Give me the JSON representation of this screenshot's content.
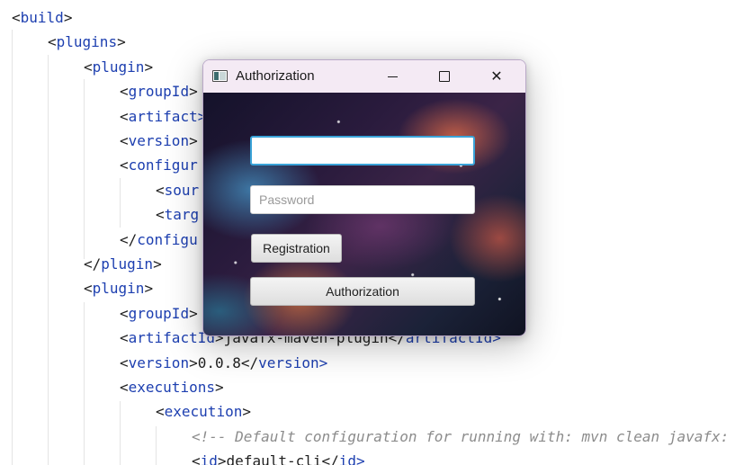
{
  "editor": {
    "lines": [
      {
        "indent": 0,
        "open": "<",
        "tag": "build",
        "close": ">",
        "text": "",
        "end": ""
      },
      {
        "indent": 1,
        "open": "<",
        "tag": "plugins",
        "close": ">",
        "text": "",
        "end": ""
      },
      {
        "indent": 2,
        "open": "<",
        "tag": "plugin",
        "close": ">",
        "text": "",
        "end": ""
      },
      {
        "indent": 3,
        "open": "<",
        "tag": "groupId",
        "close": ">",
        "text": "",
        "end": ""
      },
      {
        "indent": 3,
        "open": "<",
        "tag": "artifact",
        "close": "",
        "text": "",
        "end": ">"
      },
      {
        "indent": 3,
        "open": "<",
        "tag": "version",
        "close": ">",
        "text": "",
        "end": ""
      },
      {
        "indent": 3,
        "open": "<",
        "tag": "configur",
        "close": "",
        "text": "",
        "end": ""
      },
      {
        "indent": 4,
        "open": "<",
        "tag": "sour",
        "close": "",
        "text": "",
        "end": ""
      },
      {
        "indent": 4,
        "open": "<",
        "tag": "targ",
        "close": "",
        "text": "",
        "end": ""
      },
      {
        "indent": 3,
        "open": "</",
        "tag": "configu",
        "close": "",
        "text": "",
        "end": ""
      },
      {
        "indent": 2,
        "open": "</",
        "tag": "plugin",
        "close": ">",
        "text": "",
        "end": ""
      },
      {
        "indent": 2,
        "open": "<",
        "tag": "plugin",
        "close": ">",
        "text": "",
        "end": ""
      },
      {
        "indent": 3,
        "open": "<",
        "tag": "groupId",
        "close": ">",
        "text": "",
        "end": ""
      },
      {
        "indent": 3,
        "open": "<",
        "tag": "artifactId",
        "close": ">",
        "text": "javafx-maven-plugin</",
        "end": "artifactId>"
      },
      {
        "indent": 3,
        "open": "<",
        "tag": "version",
        "close": ">",
        "text": "0.0.8</",
        "end": "version>"
      },
      {
        "indent": 3,
        "open": "<",
        "tag": "executions",
        "close": ">",
        "text": "",
        "end": ""
      },
      {
        "indent": 4,
        "open": "<",
        "tag": "execution",
        "close": ">",
        "text": "",
        "end": ""
      },
      {
        "indent": 5,
        "comment": "<!-- Default configuration for running with: mvn clean javafx:"
      },
      {
        "indent": 5,
        "open": "<",
        "tag": "id",
        "close": ">",
        "text": "default-cli</",
        "end": "id>"
      }
    ]
  },
  "window": {
    "title": "Authorization",
    "minimize_icon": "minimize-icon",
    "maximize_icon": "maximize-icon",
    "close_icon": "close-icon",
    "close_glyph": "✕",
    "background": "nebula-space-image",
    "login": {
      "value": "",
      "placeholder": ""
    },
    "password": {
      "value": "",
      "placeholder": "Password"
    },
    "registration_label": "Registration",
    "authorization_label": "Authorization",
    "focus_color": "#3aa3d8"
  }
}
